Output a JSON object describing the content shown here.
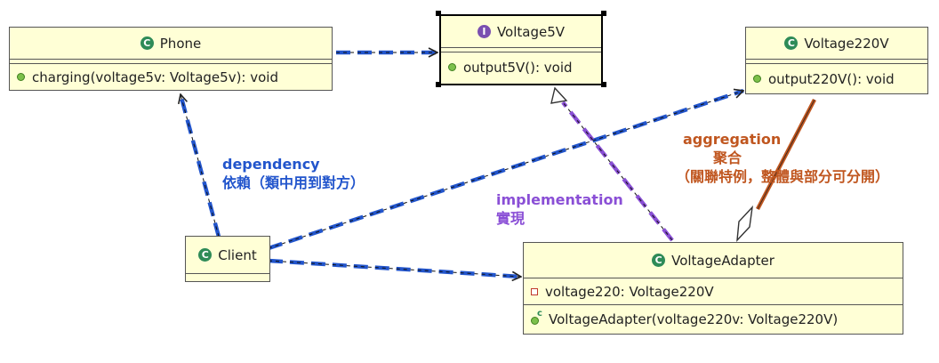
{
  "colors": {
    "dependency": "#2255cc",
    "implementation": "#8a4fd6",
    "aggregation": "#c0561f",
    "class_fill": "#ffffd6",
    "class_badge": "#2e8b57",
    "interface_badge": "#7a4fb0"
  },
  "classes": {
    "phone": {
      "name": "Phone",
      "badge": "C",
      "method": "charging(voltage5v: Voltage5v): void"
    },
    "voltage5v": {
      "name": "Voltage5V",
      "badge": "I",
      "method": "output5V(): void"
    },
    "voltage220v": {
      "name": "Voltage220V",
      "badge": "C",
      "method": "output220V(): void"
    },
    "client": {
      "name": "Client",
      "badge": "C"
    },
    "adapter": {
      "name": "VoltageAdapter",
      "badge": "C",
      "field": "voltage220: Voltage220V",
      "ctor_badge": "c",
      "constructor": "VoltageAdapter(voltage220v: Voltage220V)"
    }
  },
  "labels": {
    "dependency": {
      "line1": "dependency",
      "line2": "依賴（類中用到對方）"
    },
    "implementation": {
      "line1": "implementation",
      "line2": "實現"
    },
    "aggregation": {
      "line1": "aggregation",
      "line2": "聚合",
      "line3": "（關聯特例，整體與部分可分開）"
    }
  }
}
